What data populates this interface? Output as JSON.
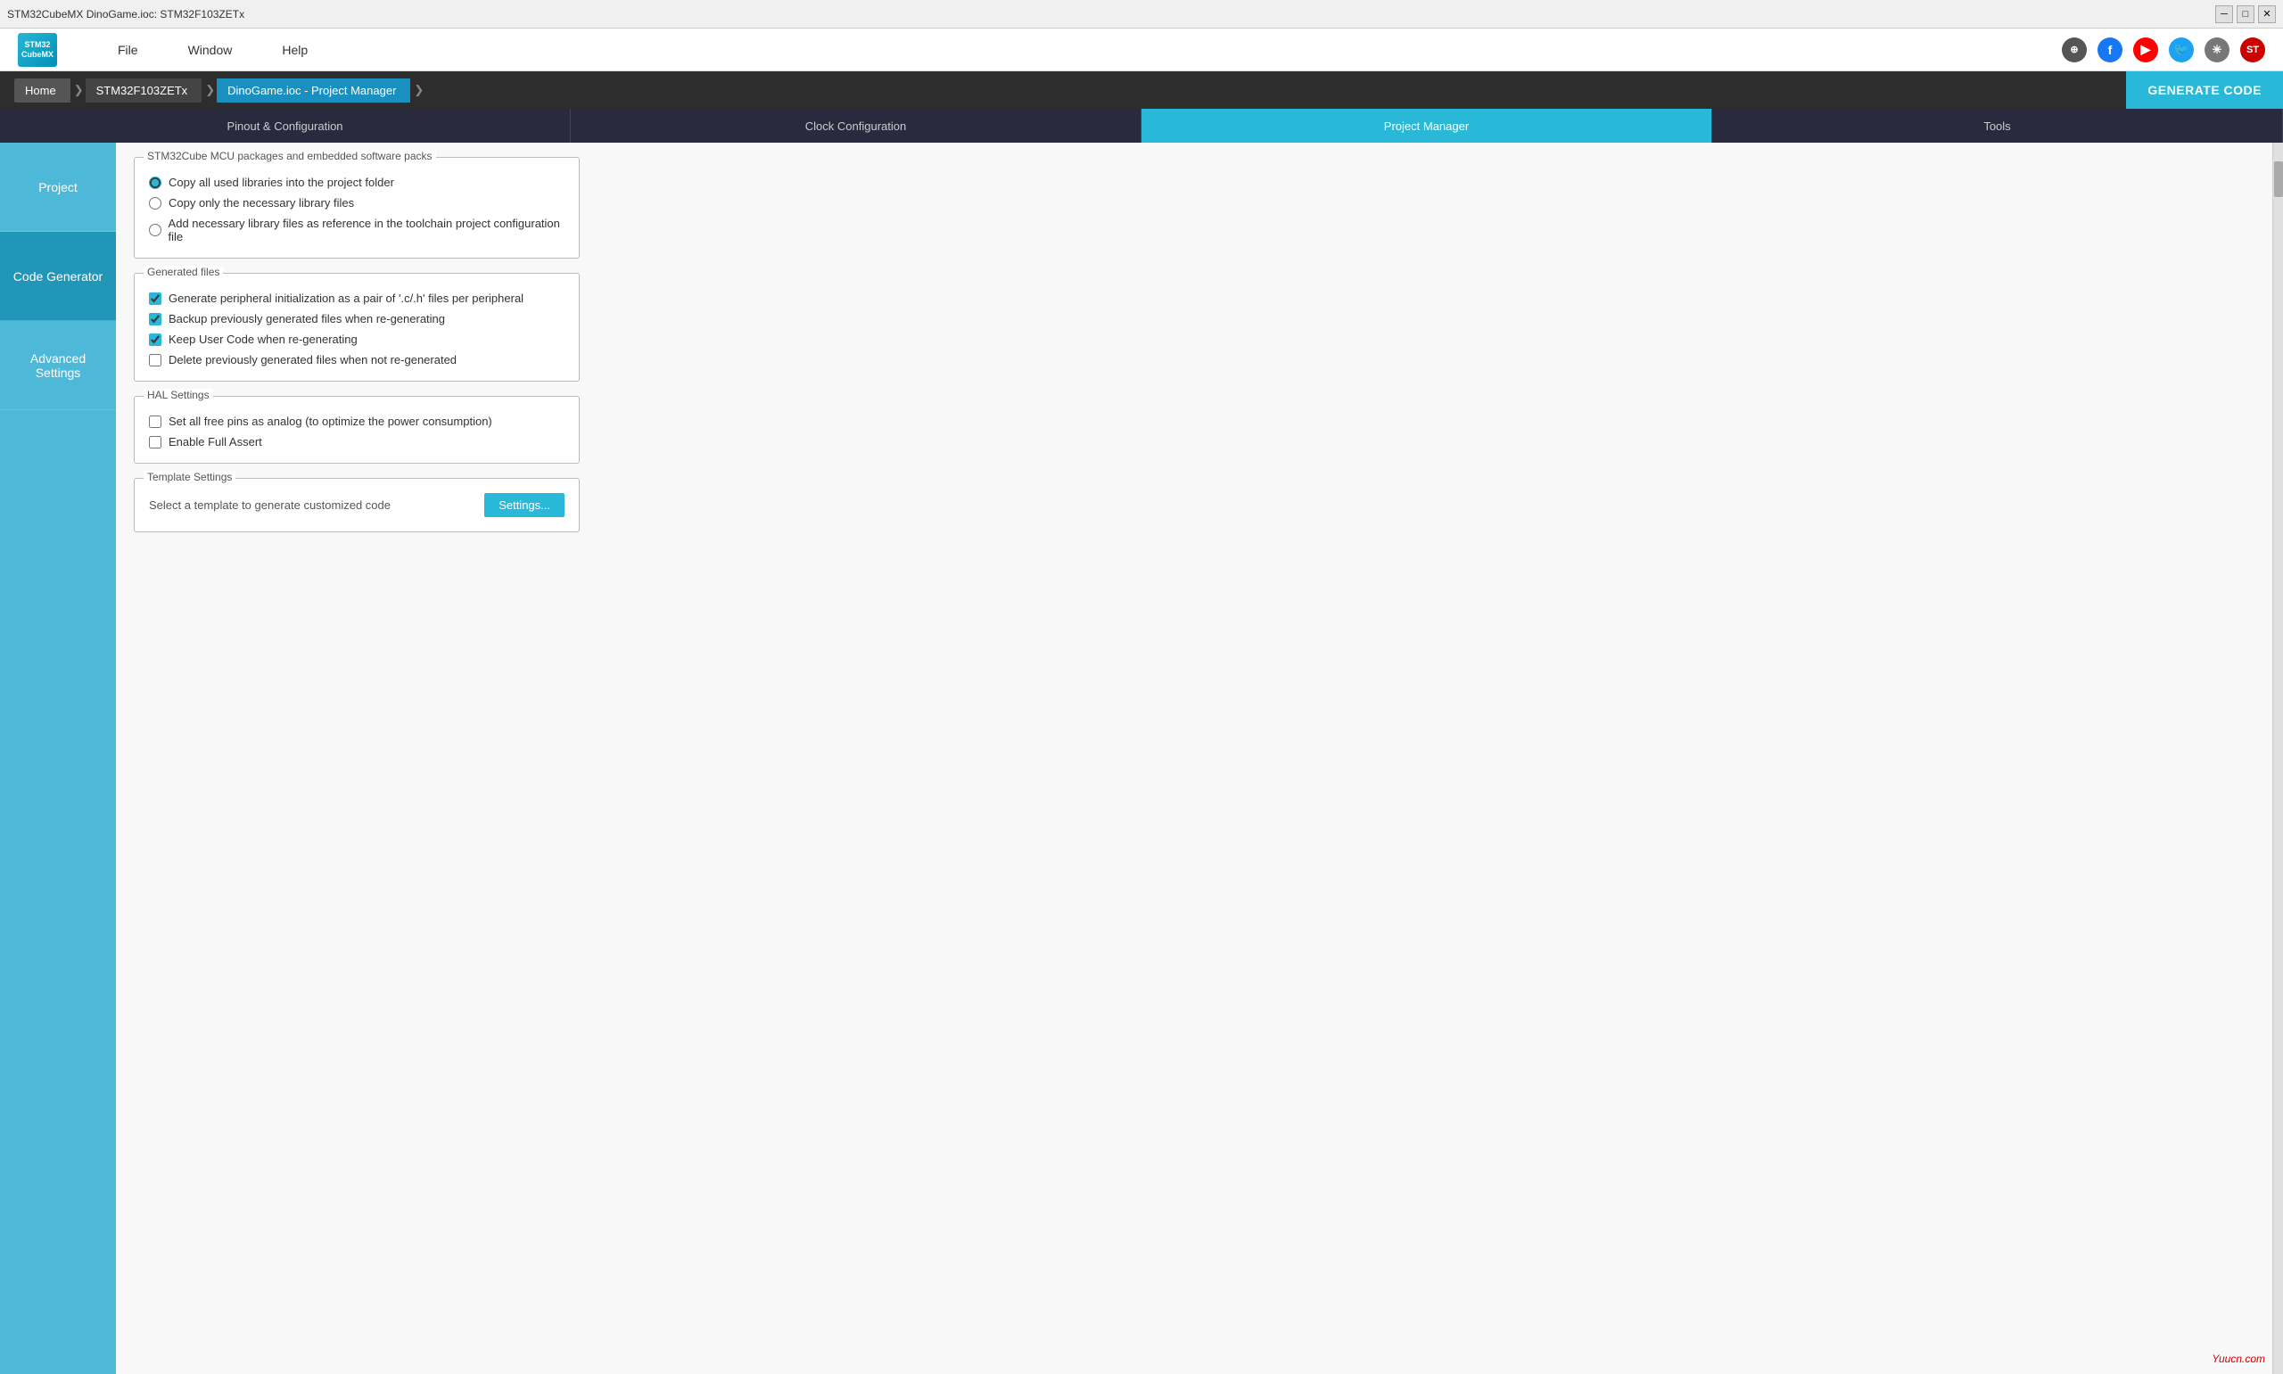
{
  "window": {
    "title": "STM32CubeMX DinoGame.ioc: STM32F103ZETx"
  },
  "titlebar": {
    "minimize": "─",
    "restore": "□",
    "close": "✕"
  },
  "menubar": {
    "logo_line1": "STM32",
    "logo_line2": "CubeMX",
    "file": "File",
    "window": "Window",
    "help": "Help"
  },
  "breadcrumb": {
    "home": "Home",
    "mcu": "STM32F103ZETx",
    "project": "DinoGame.ioc - Project Manager",
    "generate_btn": "GENERATE CODE"
  },
  "tabs": [
    {
      "id": "pinout",
      "label": "Pinout & Configuration"
    },
    {
      "id": "clock",
      "label": "Clock Configuration"
    },
    {
      "id": "project_manager",
      "label": "Project Manager",
      "active": true
    },
    {
      "id": "tools",
      "label": "Tools"
    }
  ],
  "sidebar": {
    "items": [
      {
        "id": "project",
        "label": "Project",
        "active": false
      },
      {
        "id": "code_generator",
        "label": "Code Generator",
        "active": true
      },
      {
        "id": "advanced_settings",
        "label": "Advanced Settings",
        "active": false
      }
    ]
  },
  "content": {
    "mcu_packages_group": {
      "legend": "STM32Cube MCU packages and embedded software packs",
      "options": [
        {
          "id": "copy_all",
          "label": "Copy all used libraries into the project folder",
          "checked": true
        },
        {
          "id": "copy_necessary",
          "label": "Copy only the necessary library files",
          "checked": false
        },
        {
          "id": "add_reference",
          "label": "Add necessary library files as reference in the toolchain project configuration file",
          "checked": false
        }
      ]
    },
    "generated_files_group": {
      "legend": "Generated files",
      "options": [
        {
          "id": "gen_peripheral",
          "label": "Generate peripheral initialization as a pair of '.c/.h' files per peripheral",
          "checked": true
        },
        {
          "id": "backup_files",
          "label": "Backup previously generated files when re-generating",
          "checked": true
        },
        {
          "id": "keep_user_code",
          "label": "Keep User Code when re-generating",
          "checked": true
        },
        {
          "id": "delete_previous",
          "label": "Delete previously generated files when not re-generated",
          "checked": false
        }
      ]
    },
    "hal_settings_group": {
      "legend": "HAL Settings",
      "options": [
        {
          "id": "free_pins_analog",
          "label": "Set all free pins as analog (to optimize the power consumption)",
          "checked": false
        },
        {
          "id": "full_assert",
          "label": "Enable Full Assert",
          "checked": false
        }
      ]
    },
    "template_settings_group": {
      "legend": "Template Settings",
      "label": "Select a template to generate customized code",
      "button": "Settings..."
    }
  },
  "watermark": "Yuucn.com"
}
